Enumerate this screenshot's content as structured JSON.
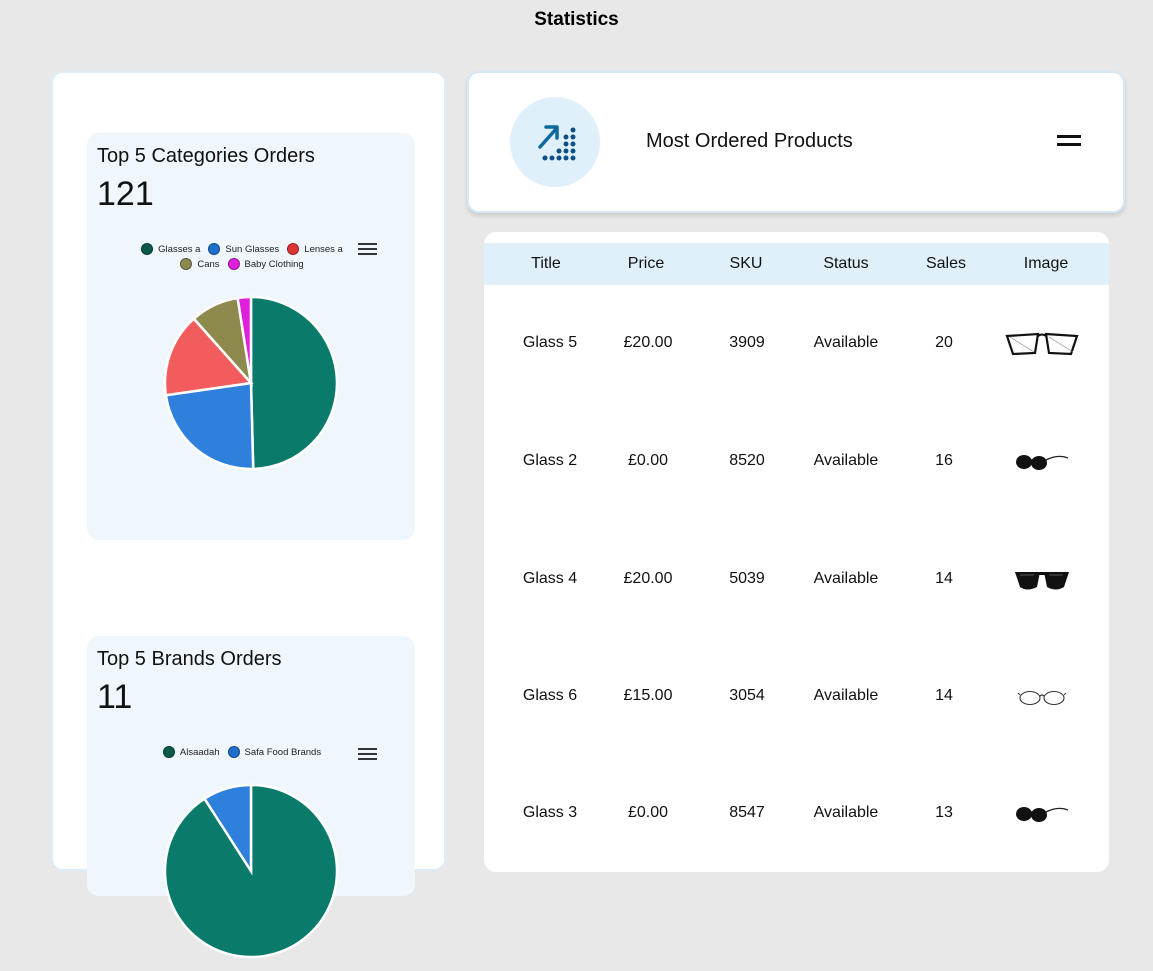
{
  "page": {
    "title": "Statistics"
  },
  "left_panel": {
    "categories_chart": {
      "title": "Top 5 Categories Orders",
      "total": "121",
      "chart_data": {
        "type": "pie",
        "categories": [
          "Glasses a",
          "Sun Glasses",
          "Lenses a",
          "Cans",
          "Baby Clothing"
        ],
        "values": [
          60,
          28,
          19,
          11,
          3
        ],
        "colors": [
          "#0a7a6a",
          "#2f7fdc",
          "#f25c5c",
          "#8e8a4e",
          "#e01fdc"
        ],
        "legend_position": "top",
        "menu_icon": "hamburger-icon"
      }
    },
    "brands_chart": {
      "title": "Top 5 Brands Orders",
      "total": "11",
      "chart_data": {
        "type": "pie",
        "categories": [
          "Alsaadah",
          "Safa Food Brands"
        ],
        "values": [
          10,
          1
        ],
        "colors": [
          "#0a7a6a",
          "#2f7fdc"
        ],
        "legend_position": "top",
        "menu_icon": "hamburger-icon"
      }
    }
  },
  "header": {
    "title": "Most Ordered Products",
    "icon": "growth-chart-icon",
    "menu_icon": "hamburger-icon"
  },
  "table": {
    "columns": [
      "Title",
      "Price",
      "SKU",
      "Status",
      "Sales",
      "Image"
    ],
    "rows": [
      {
        "title": "Glass 5",
        "price": "£20.00",
        "sku": "3909",
        "status": "Available",
        "sales": "20",
        "image": "clear-frame-glasses-icon"
      },
      {
        "title": "Glass 2",
        "price": "£0.00",
        "sku": "8520",
        "status": "Available",
        "sales": "16",
        "image": "sunglasses-side-icon"
      },
      {
        "title": "Glass 4",
        "price": "£20.00",
        "sku": "5039",
        "status": "Available",
        "sales": "14",
        "image": "black-sunglasses-icon"
      },
      {
        "title": "Glass 6",
        "price": "£15.00",
        "sku": "3054",
        "status": "Available",
        "sales": "14",
        "image": "thin-round-glasses-icon"
      },
      {
        "title": "Glass 3",
        "price": "£0.00",
        "sku": "8547",
        "status": "Available",
        "sales": "13",
        "image": "sunglasses-side-icon"
      }
    ]
  }
}
